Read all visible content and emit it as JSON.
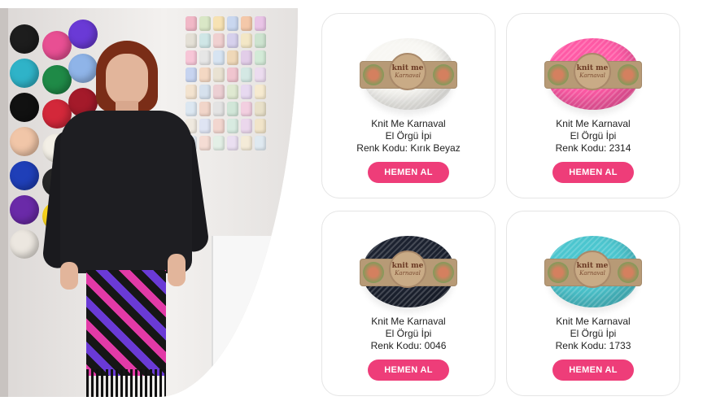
{
  "products": [
    {
      "name": "Knit Me Karnaval",
      "type": "El Örgü İpi",
      "code": "Renk Kodu: Kırık Beyaz",
      "button": "HEMEN AL",
      "yarn_color": "#f8f7f3",
      "label_logo": "knit me",
      "label_script": "Karnaval"
    },
    {
      "name": "Knit Me Karnaval",
      "type": "El Örgü İpi",
      "code": "Renk Kodu: 2314",
      "button": "HEMEN AL",
      "yarn_color": "#ff5aa6",
      "label_logo": "knit me",
      "label_script": "Karnaval"
    },
    {
      "name": "Knit Me Karnaval",
      "type": "El Örgü İpi",
      "code": "Renk Kodu: 0046",
      "button": "HEMEN AL",
      "yarn_color": "#1c2230",
      "label_logo": "knit me",
      "label_script": "Karnaval"
    },
    {
      "name": "Knit Me Karnaval",
      "type": "El Örgü İpi",
      "code": "Renk Kodu: 1733",
      "button": "HEMEN AL",
      "yarn_color": "#4cc6cf",
      "label_logo": "knit me",
      "label_script": "Karnaval"
    }
  ],
  "colors": {
    "button_bg": "#ee3d79",
    "card_border": "#e5e5e5"
  }
}
